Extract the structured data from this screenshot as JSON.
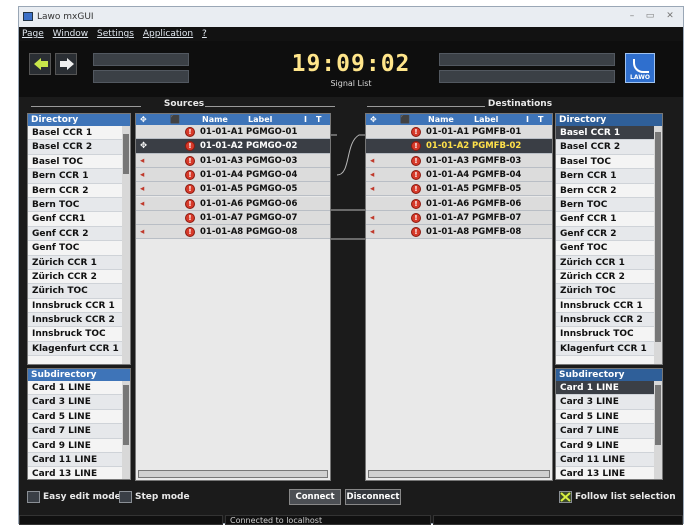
{
  "window": {
    "title": "Lawo mxGUI",
    "buttons": [
      "–",
      "▭",
      "✕"
    ]
  },
  "menu": [
    "Page",
    "Window",
    "Settings",
    "Application",
    "?"
  ],
  "top": {
    "clock": "19:09:02",
    "subtitle": "Signal List",
    "logo": "LAWO"
  },
  "sources": {
    "section_label": "Sources",
    "directory_header": "Directory",
    "directory": [
      "Basel CCR 1",
      "Basel CCR 2",
      "Basel TOC",
      "Bern CCR 1",
      "Bern CCR 2",
      "Bern TOC",
      "Genf CCR1",
      "Genf CCR 2",
      "Genf TOC",
      "Zürich CCR 1",
      "Zürich CCR 2",
      "Zürich TOC",
      "Innsbruck CCR 1",
      "Innsbruck CCR 2",
      "Innsbruck TOC",
      "Klagenfurt CCR 1"
    ],
    "subdirectory_header": "Subdirectory",
    "subdirectory": [
      "Card 1 LINE",
      "Card 3 LINE",
      "Card 5 LINE",
      "Card 7 LINE",
      "Card 9 LINE",
      "Card 11 LINE",
      "Card 13 LINE"
    ],
    "columns": {
      "name": "Name",
      "label": "Label",
      "col1": "I",
      "col2": "T"
    },
    "rows": [
      {
        "name": "01-01-A1",
        "label": "PGMGO-01",
        "mark": ""
      },
      {
        "name": "01-01-A2",
        "label": "PGMGO-02",
        "mark": "✥"
      },
      {
        "name": "01-01-A3",
        "label": "PGMGO-03",
        "mark": "◂"
      },
      {
        "name": "01-01-A4",
        "label": "PGMGO-04",
        "mark": "◂"
      },
      {
        "name": "01-01-A5",
        "label": "PGMGO-05",
        "mark": "◂"
      },
      {
        "name": "01-01-A6",
        "label": "PGMGO-06",
        "mark": "◂"
      },
      {
        "name": "01-01-A7",
        "label": "PGMGO-07",
        "mark": ""
      },
      {
        "name": "01-01-A8",
        "label": "PGMGO-08",
        "mark": "◂"
      }
    ]
  },
  "destinations": {
    "section_label": "Destinations",
    "directory_header": "Directory",
    "directory": [
      "Basel CCR 1",
      "Basel CCR 2",
      "Basel TOC",
      "Bern CCR 1",
      "Bern CCR 2",
      "Bern TOC",
      "Genf CCR 1",
      "Genf CCR 2",
      "Genf TOC",
      "Zürich CCR 1",
      "Zürich CCR 2",
      "Zürich TOC",
      "Innsbruck CCR 1",
      "Innsbruck CCR 2",
      "Innsbruck TOC",
      "Klagenfurt CCR 1"
    ],
    "subdirectory_header": "Subdirectory",
    "subdirectory": [
      "Card 1 LINE",
      "Card 3 LINE",
      "Card 5 LINE",
      "Card 7 LINE",
      "Card 9 LINE",
      "Card 11 LINE",
      "Card 13 LINE"
    ],
    "columns": {
      "name": "Name",
      "label": "Label",
      "col1": "I",
      "col2": "T"
    },
    "rows": [
      {
        "name": "01-01-A1",
        "label": "PGMFB-01",
        "mark": ""
      },
      {
        "name": "01-01-A2",
        "label": "PGMFB-02",
        "mark": ""
      },
      {
        "name": "01-01-A3",
        "label": "PGMFB-03",
        "mark": "◂"
      },
      {
        "name": "01-01-A4",
        "label": "PGMFB-04",
        "mark": "◂"
      },
      {
        "name": "01-01-A5",
        "label": "PGMFB-05",
        "mark": "◂"
      },
      {
        "name": "01-01-A6",
        "label": "PGMFB-06",
        "mark": ""
      },
      {
        "name": "01-01-A7",
        "label": "PGMFB-07",
        "mark": "◂"
      },
      {
        "name": "01-01-A8",
        "label": "PGMFB-08",
        "mark": "◂"
      }
    ]
  },
  "bottom": {
    "easy_edit": "Easy edit mode",
    "step_mode": "Step mode",
    "connect": "Connect",
    "disconnect": "Disconnect",
    "follow": "Follow list selection"
  },
  "statusbar": {
    "message": "Connected to localhost"
  },
  "colors": {
    "header": "#3e74b8",
    "clock": "#ffe58a",
    "alert": "#d73a2a",
    "selected_text": "#ffe14a"
  }
}
